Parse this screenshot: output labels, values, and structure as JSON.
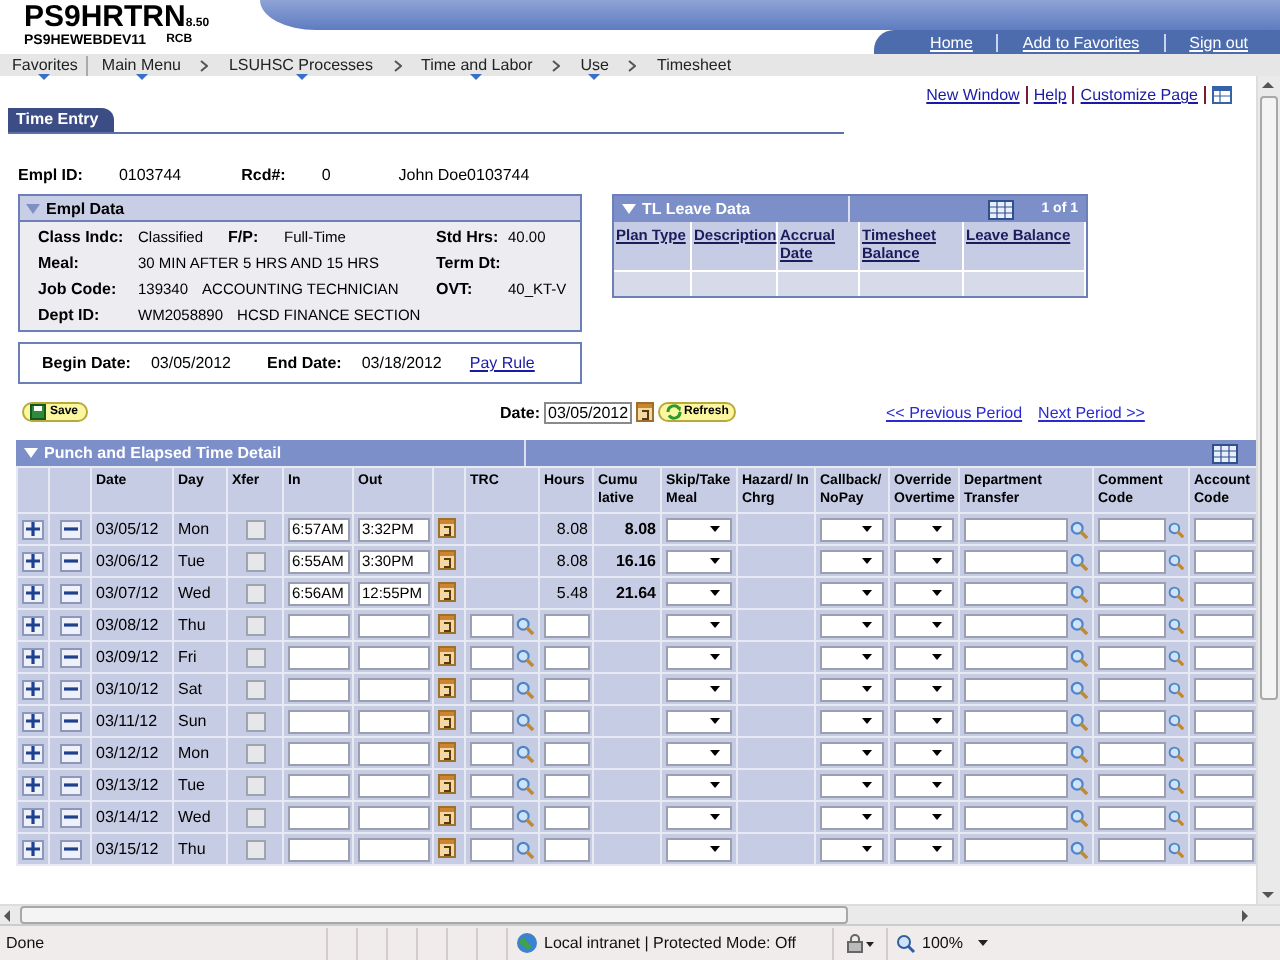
{
  "app": {
    "title": "PS9HRTRN",
    "version": "8.50",
    "environment": "PS9HEWEBDEV11",
    "user": "RCB"
  },
  "header_links": [
    "Home",
    "Add to Favorites",
    "Sign out"
  ],
  "breadcrumbs": [
    {
      "label": "Favorites",
      "menu": true
    },
    {
      "label": "Main Menu",
      "menu": true
    },
    {
      "label": "LSUHSC Processes",
      "menu": true
    },
    {
      "label": "Time and Labor",
      "menu": true
    },
    {
      "label": "Use",
      "menu": true
    },
    {
      "label": "Timesheet",
      "menu": false
    }
  ],
  "page_links": [
    "New Window",
    "Help",
    "Customize Page"
  ],
  "tabs": [
    {
      "label": "Time Entry",
      "selected": true
    }
  ],
  "employee": {
    "fields": [
      {
        "label": "Empl ID:",
        "value": "0103744"
      },
      {
        "label": "Rcd#:",
        "value": "0"
      }
    ],
    "name": "John Doe0103744"
  },
  "empl_data": {
    "title": "Empl Data",
    "expanded": true,
    "fields": [
      {
        "label": "Class Indc:",
        "values": [
          "Classified"
        ]
      },
      {
        "label": "F/P:",
        "values": [
          "Full-Time"
        ]
      },
      {
        "label": "Std Hrs:",
        "values": [
          "40.00"
        ]
      },
      {
        "label": "Meal:",
        "values": [
          "30 MIN AFTER 5 HRS AND 15 HRS"
        ]
      },
      {
        "label": "Term Dt:"
      },
      {
        "label": "Job Code:",
        "values": [
          "139340",
          "ACCOUNTING TECHNICIAN"
        ]
      },
      {
        "label": "OVT:",
        "values": [
          "40_KT-V"
        ]
      },
      {
        "label": "Dept ID:",
        "values": [
          "WM2058890",
          "HCSD FINANCE SECTION"
        ]
      }
    ]
  },
  "period": {
    "fields": [
      {
        "label": "Begin Date:",
        "value": "03/05/2012"
      },
      {
        "label": "End Date:",
        "value": "03/18/2012"
      }
    ],
    "link": "Pay Rule"
  },
  "leave_data": {
    "title": "TL Leave Data",
    "expanded": true,
    "counter": "1 of 1",
    "columns": [
      "Plan Type",
      "Description",
      "Accrual Date",
      "Timesheet Balance",
      "Leave Balance"
    ]
  },
  "actions": {
    "save": "Save",
    "date_label": "Date:",
    "date_value": "03/05/2012",
    "refresh": "Refresh",
    "previous": "<< Previous Period",
    "next": "Next Period >>"
  },
  "time_detail": {
    "title": "Punch and Elapsed Time Detail",
    "expanded": true,
    "columns": [
      "Date",
      "Day",
      "Xfer",
      "In",
      "Out",
      "TRC",
      "Hours",
      "Cumu lative",
      "Skip/Take Meal",
      "Hazard/ In Chrg",
      "Callback/ NoPay",
      "Override Overtime",
      "Department Transfer",
      "Comment Code",
      "Account Code"
    ],
    "rows": [
      {
        "date": "03/05/12",
        "day": "Mon",
        "xfer": false,
        "in": "6:57AM",
        "out": "3:32PM",
        "hours": "8.08",
        "cumulative": "8.08"
      },
      {
        "date": "03/06/12",
        "day": "Tue",
        "xfer": false,
        "in": "6:55AM",
        "out": "3:30PM",
        "hours": "8.08",
        "cumulative": "16.16"
      },
      {
        "date": "03/07/12",
        "day": "Wed",
        "xfer": false,
        "in": "6:56AM",
        "out": "12:55PM",
        "hours": "5.48",
        "cumulative": "21.64"
      },
      {
        "date": "03/08/12",
        "day": "Thu",
        "xfer": false
      },
      {
        "date": "03/09/12",
        "day": "Fri",
        "xfer": false
      },
      {
        "date": "03/10/12",
        "day": "Sat",
        "xfer": false
      },
      {
        "date": "03/11/12",
        "day": "Sun",
        "xfer": false
      },
      {
        "date": "03/12/12",
        "day": "Mon",
        "xfer": false
      },
      {
        "date": "03/13/12",
        "day": "Tue",
        "xfer": false
      },
      {
        "date": "03/14/12",
        "day": "Wed",
        "xfer": false
      },
      {
        "date": "03/15/12",
        "day": "Thu",
        "xfer": false
      }
    ]
  },
  "status_bar": {
    "message": "Done",
    "zone": "Local intranet | Protected Mode: Off",
    "zoom": "100%"
  }
}
